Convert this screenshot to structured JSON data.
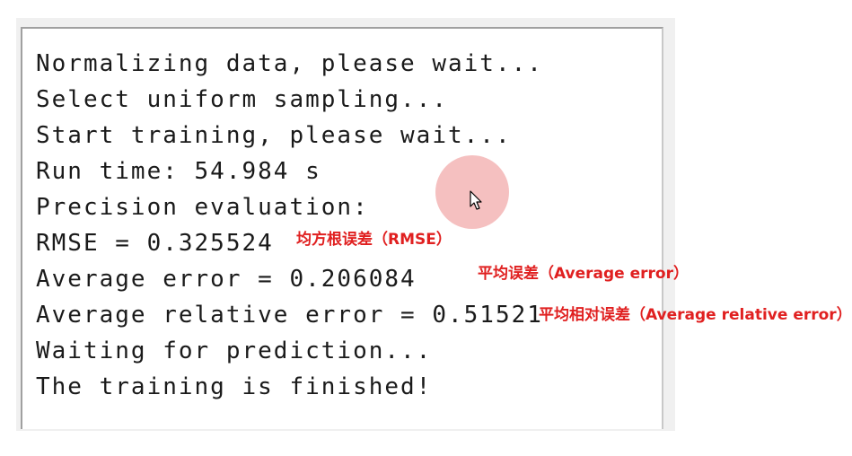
{
  "log": {
    "lines": [
      "Normalizing data, please wait...",
      "Select uniform sampling...",
      "Start training, please wait...",
      "Run time: 54.984 s",
      "Precision evaluation:",
      "RMSE = 0.325524",
      "Average error = 0.206084",
      "Average relative error = 0.51521",
      "Waiting for prediction...",
      "The training is finished!"
    ]
  },
  "annotations": {
    "rmse": "均方根误差（RMSE）",
    "average_error": "平均误差（Average error）",
    "average_relative_error": "平均相对误差（Average relative error）"
  },
  "colors": {
    "annotation": "#e02020",
    "cursor_highlight": "#ec8c8c",
    "log_text": "#1a1a1a"
  },
  "icons": {
    "cursor": "mouse-pointer-icon"
  }
}
